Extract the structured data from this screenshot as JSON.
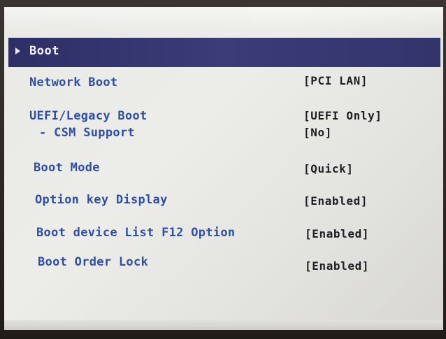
{
  "section": {
    "title": "Boot"
  },
  "settings": [
    {
      "label": "Network Boot",
      "value": "[PCI LAN]"
    },
    {
      "label": "UEFI/Legacy Boot",
      "value": "[UEFI Only]"
    },
    {
      "label": "- CSM Support",
      "value": "[No]"
    },
    {
      "label": "Boot Mode",
      "value": "[Quick]"
    },
    {
      "label": "Option key Display",
      "value": "[Enabled]"
    },
    {
      "label": "Boot device List F12 Option",
      "value": "[Enabled]"
    },
    {
      "label": "Boot Order Lock",
      "value": "[Enabled]"
    }
  ],
  "colors": {
    "section_bar": "#33346c",
    "label_text": "#2f4ea6",
    "value_text": "#1f1f24",
    "screen_bg": "#e9e9e6"
  }
}
